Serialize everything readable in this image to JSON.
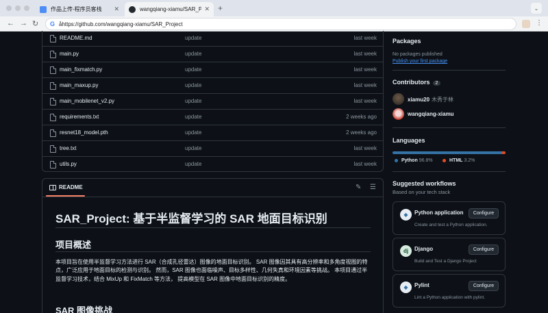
{
  "browser": {
    "tabs": [
      {
        "title": "作品上传-程序员客栈",
        "active": false
      },
      {
        "title": "wangqiang-xiamu/SAR_Project",
        "active": true
      }
    ],
    "url": "åhttps://github.com/wangqiang-xiamu/SAR_Project"
  },
  "files": [
    {
      "name": "README.md",
      "commit": "update",
      "date": "last week"
    },
    {
      "name": "main.py",
      "commit": "update",
      "date": "last week"
    },
    {
      "name": "main_fixmatch.py",
      "commit": "update",
      "date": "last week"
    },
    {
      "name": "main_maxup.py",
      "commit": "update",
      "date": "last week"
    },
    {
      "name": "main_mobilenet_v2.py",
      "commit": "update",
      "date": "last week"
    },
    {
      "name": "requirements.txt",
      "commit": "update",
      "date": "2 weeks ago"
    },
    {
      "name": "resnet18_model.pth",
      "commit": "update",
      "date": "2 weeks ago"
    },
    {
      "name": "tree.txt",
      "commit": "update",
      "date": "last week"
    },
    {
      "name": "utils.py",
      "commit": "update",
      "date": "last week"
    }
  ],
  "readme": {
    "label": "README",
    "title": "SAR_Project: 基于半监督学习的 SAR 地面目标识别",
    "section1": "项目概述",
    "para1": "本项目旨在使用半监督学习方法进行 SAR（合成孔径雷达）图像的地面目标识别。 SAR 图像因其具有高分辨率和多角度视图的特点，广泛应用于地面目标的检测与识别。 然而，SAR 图像也面临噪声、目标多样性、几何失真和环境因素等挑战。 本项目通过半监督学习技术，结合 MixUp 和 FixMatch 等方法， 提高模型在 SAR 图像中地面目标识别的精度。",
    "section2": "SAR 图像挑战"
  },
  "sidebar": {
    "packages": {
      "heading": "Packages",
      "empty_text": "No packages published",
      "link": "Publish your first package"
    },
    "contributors": {
      "heading": "Contributors",
      "count": "2",
      "people": [
        {
          "login": "xiamu20",
          "name": "木秀于林"
        },
        {
          "login": "wangqiang-xiamu",
          "name": ""
        }
      ]
    },
    "languages": {
      "heading": "Languages",
      "items": [
        {
          "name": "Python",
          "percent": "96.8%",
          "value": 96.8,
          "color": "#3572A5"
        },
        {
          "name": "HTML",
          "percent": "3.2%",
          "value": 3.2,
          "color": "#e34c26"
        }
      ]
    },
    "workflows": {
      "heading": "Suggested workflows",
      "subheading": "Based on your tech stack",
      "items": [
        {
          "name": "Python application",
          "description": "Create and test a Python application.",
          "button": "Configure",
          "icon": "python-logo"
        },
        {
          "name": "Django",
          "description": "Build and Test a Django Project",
          "button": "Configure",
          "icon": "django-logo"
        },
        {
          "name": "Pylint",
          "description": "Lint a Python application with pylint.",
          "button": "Configure",
          "icon": "python-logo"
        }
      ]
    }
  }
}
